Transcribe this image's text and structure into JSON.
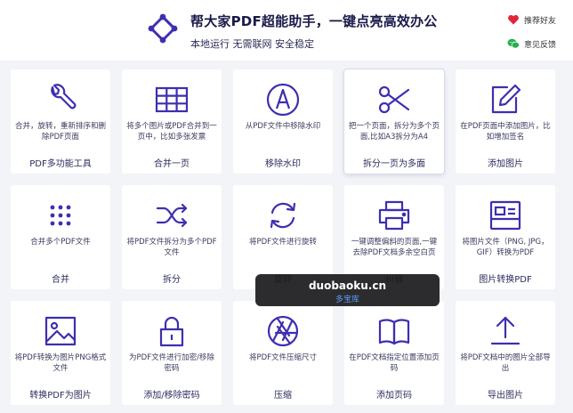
{
  "header": {
    "title": "帮大家PDF超能助手，一键点亮高效办公",
    "subtitle": "本地运行 无需联网 安全稳定",
    "recommend_label": "推荐好友",
    "feedback_label": "意见反馈",
    "accent_color": "#3d2fb0",
    "logo_icon": "network-diamond-icon"
  },
  "tools": [
    {
      "icon": "wrench-icon",
      "desc": "合并，旋转，重新排序和删除PDF页面",
      "name": "PDF多功能工具"
    },
    {
      "icon": "grid-table-icon",
      "desc": "将多个图片或PDF合并到一页中，比如多张发票",
      "name": "合并一页"
    },
    {
      "icon": "remove-watermark-icon",
      "desc": "从PDF文件中移除水印",
      "name": "移除水印"
    },
    {
      "icon": "scissors-icon",
      "desc": "把一个页面，拆分为多个页面,比如A3拆分为A4",
      "name": "拆分一页为多面"
    },
    {
      "icon": "edit-pen-icon",
      "desc": "在PDF页面中添加图片，比如增加签名",
      "name": "添加图片"
    },
    {
      "icon": "dots-grid-icon",
      "desc": "合并多个PDF文件",
      "name": "合并"
    },
    {
      "icon": "shuffle-split-icon",
      "desc": "将PDF文件拆分为多个PDF文件",
      "name": "拆分"
    },
    {
      "icon": "rotate-icon",
      "desc": "将PDF文件进行旋转",
      "name": "旋转"
    },
    {
      "icon": "printer-icon",
      "desc": "一键调整偏斜的页面,一键去除PDF文档多余空白页",
      "name": "纠偏"
    },
    {
      "icon": "image-card-icon",
      "desc": "将图片文件（PNG, JPG，GIF）转换为PDF",
      "name": "图片转换PDF"
    },
    {
      "icon": "picture-icon",
      "desc": "将PDF转换为图片PNG格式文件",
      "name": "转换PDF为图片"
    },
    {
      "icon": "lock-icon",
      "desc": "为PDF文件进行加密/移除密码",
      "name": "添加/移除密码"
    },
    {
      "icon": "aperture-icon",
      "desc": "将PDF文件压缩尺寸",
      "name": "压缩"
    },
    {
      "icon": "open-book-icon",
      "desc": "在PDF文档指定位置添加页码",
      "name": "添加页码"
    },
    {
      "icon": "upload-arrow-icon",
      "desc": "将PDF文档中的图片全部导出",
      "name": "导出图片"
    }
  ],
  "watermark": {
    "domain": "duobaoku.cn",
    "label": "多宝库"
  }
}
